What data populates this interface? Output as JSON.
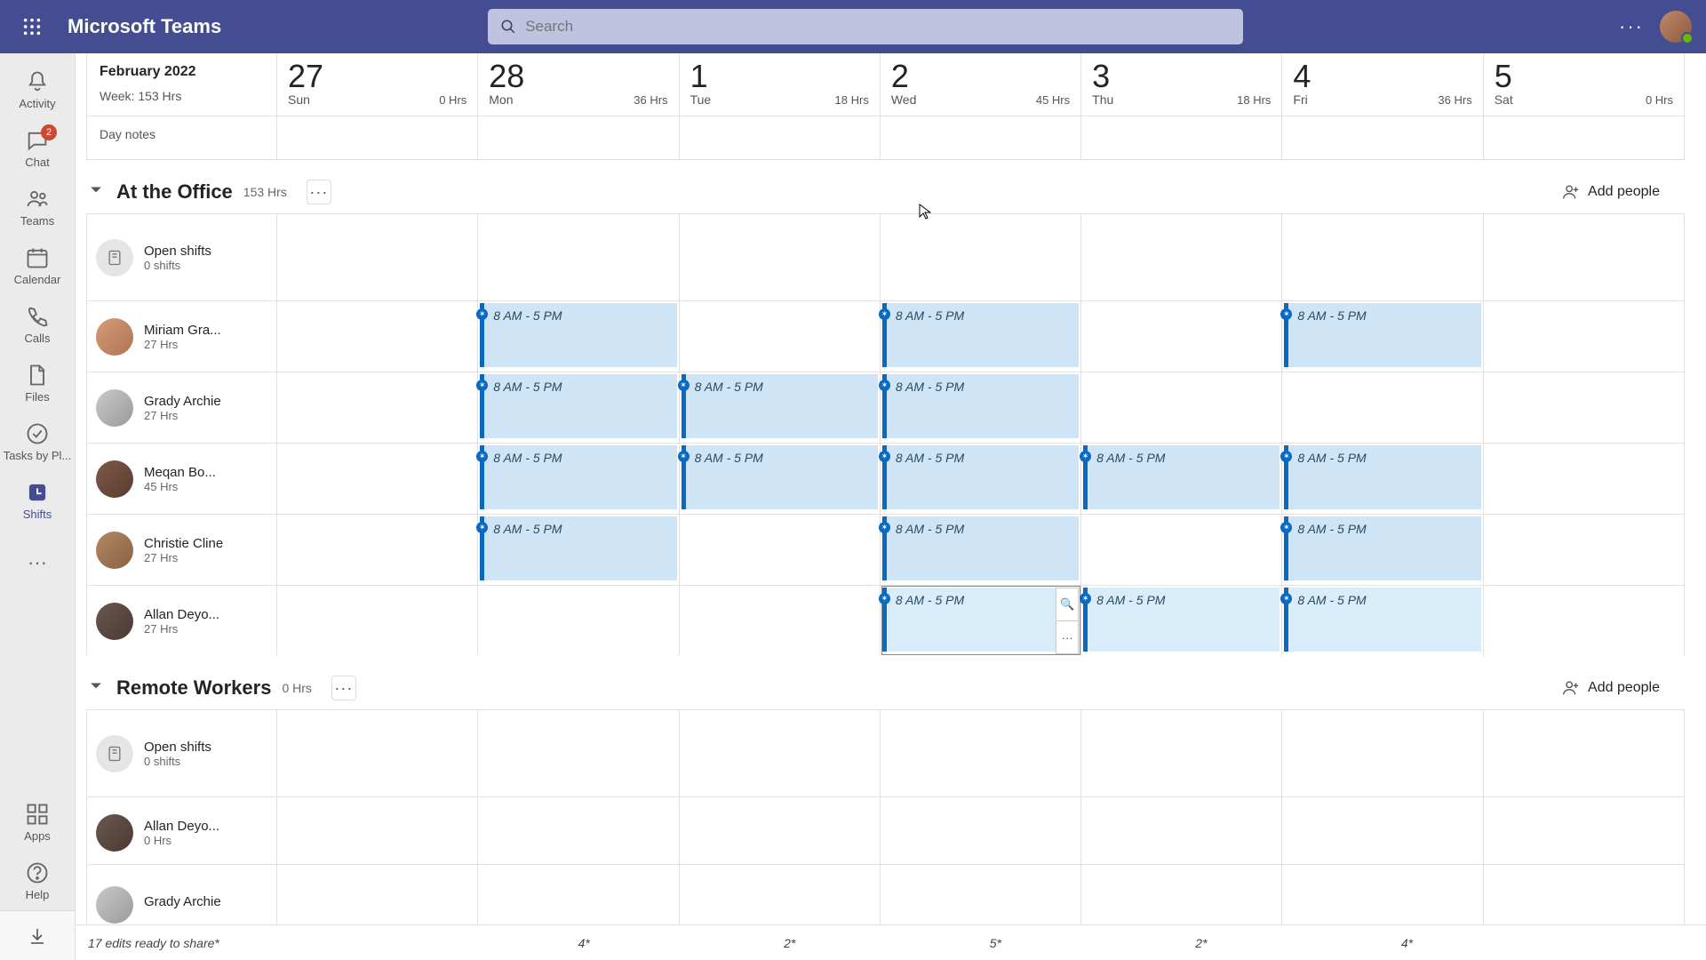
{
  "app": {
    "title": "Microsoft Teams"
  },
  "search": {
    "placeholder": "Search"
  },
  "rail": {
    "activity": "Activity",
    "chat": "Chat",
    "chat_badge": "2",
    "teams": "Teams",
    "calendar": "Calendar",
    "calls": "Calls",
    "files": "Files",
    "tasks": "Tasks by Pl...",
    "shifts": "Shifts",
    "apps": "Apps",
    "help": "Help"
  },
  "week": {
    "month": "February 2022",
    "summary": "Week: 153 Hrs",
    "day_notes_label": "Day notes",
    "days": [
      {
        "num": "27",
        "name": "Sun",
        "hrs": "0 Hrs"
      },
      {
        "num": "28",
        "name": "Mon",
        "hrs": "36 Hrs"
      },
      {
        "num": "1",
        "name": "Tue",
        "hrs": "18 Hrs"
      },
      {
        "num": "2",
        "name": "Wed",
        "hrs": "45 Hrs"
      },
      {
        "num": "3",
        "name": "Thu",
        "hrs": "18 Hrs"
      },
      {
        "num": "4",
        "name": "Fri",
        "hrs": "36 Hrs"
      },
      {
        "num": "5",
        "name": "Sat",
        "hrs": "0 Hrs"
      }
    ]
  },
  "shift_label": "8 AM - 5 PM",
  "groups": [
    {
      "title": "At the Office",
      "hours": "153 Hrs",
      "add_label": "Add people",
      "open": {
        "name": "Open shifts",
        "sub": "0 shifts"
      },
      "people": [
        {
          "name": "Miriam Gra...",
          "sub": "27 Hrs",
          "shifts": [
            1,
            3,
            5
          ]
        },
        {
          "name": "Grady Archie",
          "sub": "27 Hrs",
          "shifts": [
            1,
            2,
            3
          ]
        },
        {
          "name": "Meqan Bo...",
          "sub": "45 Hrs",
          "shifts": [
            1,
            2,
            3,
            4,
            5
          ]
        },
        {
          "name": "Christie Cline",
          "sub": "27 Hrs",
          "shifts": [
            1,
            3,
            5
          ]
        },
        {
          "name": "Allan Deyo...",
          "sub": "27 Hrs",
          "shifts": [
            3,
            4,
            5
          ],
          "selected_day": 3
        }
      ]
    },
    {
      "title": "Remote Workers",
      "hours": "0 Hrs",
      "add_label": "Add people",
      "open": {
        "name": "Open shifts",
        "sub": "0 shifts"
      },
      "people": [
        {
          "name": "Allan Deyo...",
          "sub": "0 Hrs",
          "shifts": []
        },
        {
          "name": "Grady Archie",
          "sub": "",
          "shifts": []
        }
      ]
    }
  ],
  "footer": {
    "status": "17 edits ready to share*",
    "cells": [
      "",
      "4*",
      "2*",
      "5*",
      "2*",
      "4*",
      ""
    ]
  }
}
